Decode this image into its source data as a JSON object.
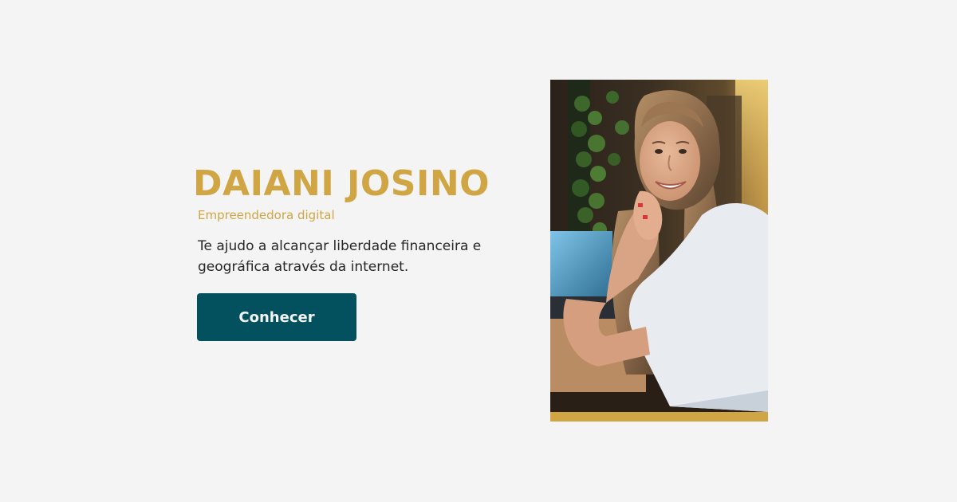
{
  "hero": {
    "name": "DAIANI JOSINO",
    "role": "Empreendedora digital",
    "tagline": "Te ajudo a alcançar liberdade financeira e geográfica através da internet.",
    "cta_label": "Conhecer"
  },
  "portrait": {
    "alt": "Retrato de Daiani Josino"
  },
  "colors": {
    "background": "#f4f4f4",
    "gold": "#d0a543",
    "teal": "#03505e",
    "text": "#262626"
  }
}
